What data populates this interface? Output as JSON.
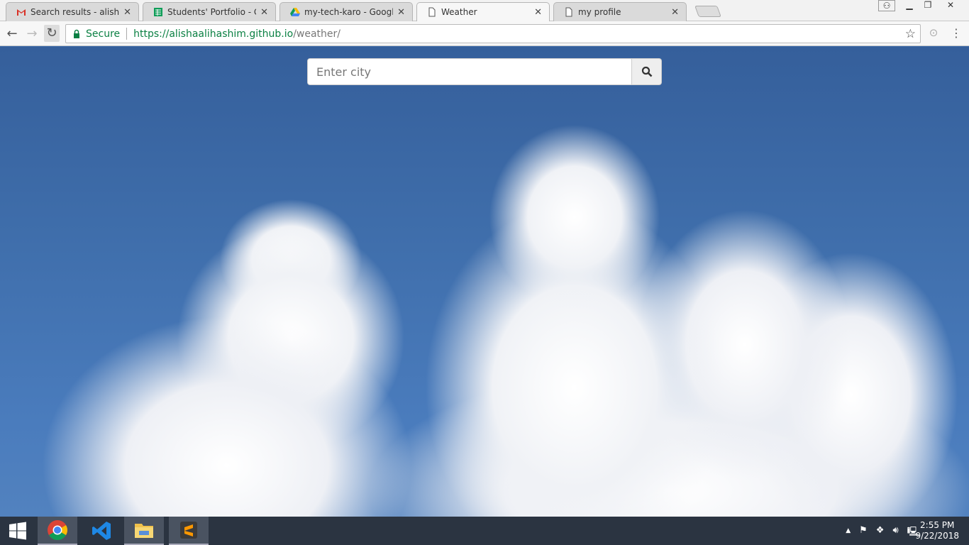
{
  "browser": {
    "tabs": [
      {
        "title": "Search results - alishaalih",
        "icon": "gmail-icon",
        "active": false
      },
      {
        "title": "Students' Portfolio - Goo",
        "icon": "sheets-icon",
        "active": false
      },
      {
        "title": "my-tech-karo - Google D",
        "icon": "drive-icon",
        "active": false
      },
      {
        "title": "Weather",
        "icon": "page-icon",
        "active": true
      },
      {
        "title": "my profile",
        "icon": "page-icon",
        "active": false
      }
    ],
    "close_glyph": "✕",
    "secure_label": "Secure",
    "url_host": "https://alishaalihashim.github.io",
    "url_path": "/weather/"
  },
  "page": {
    "search_placeholder": "Enter city",
    "search_value": ""
  },
  "taskbar": {
    "time": "2:55 PM",
    "date": "9/22/2018",
    "apps": [
      "chrome",
      "vscode",
      "file-explorer",
      "sublime-text"
    ]
  }
}
